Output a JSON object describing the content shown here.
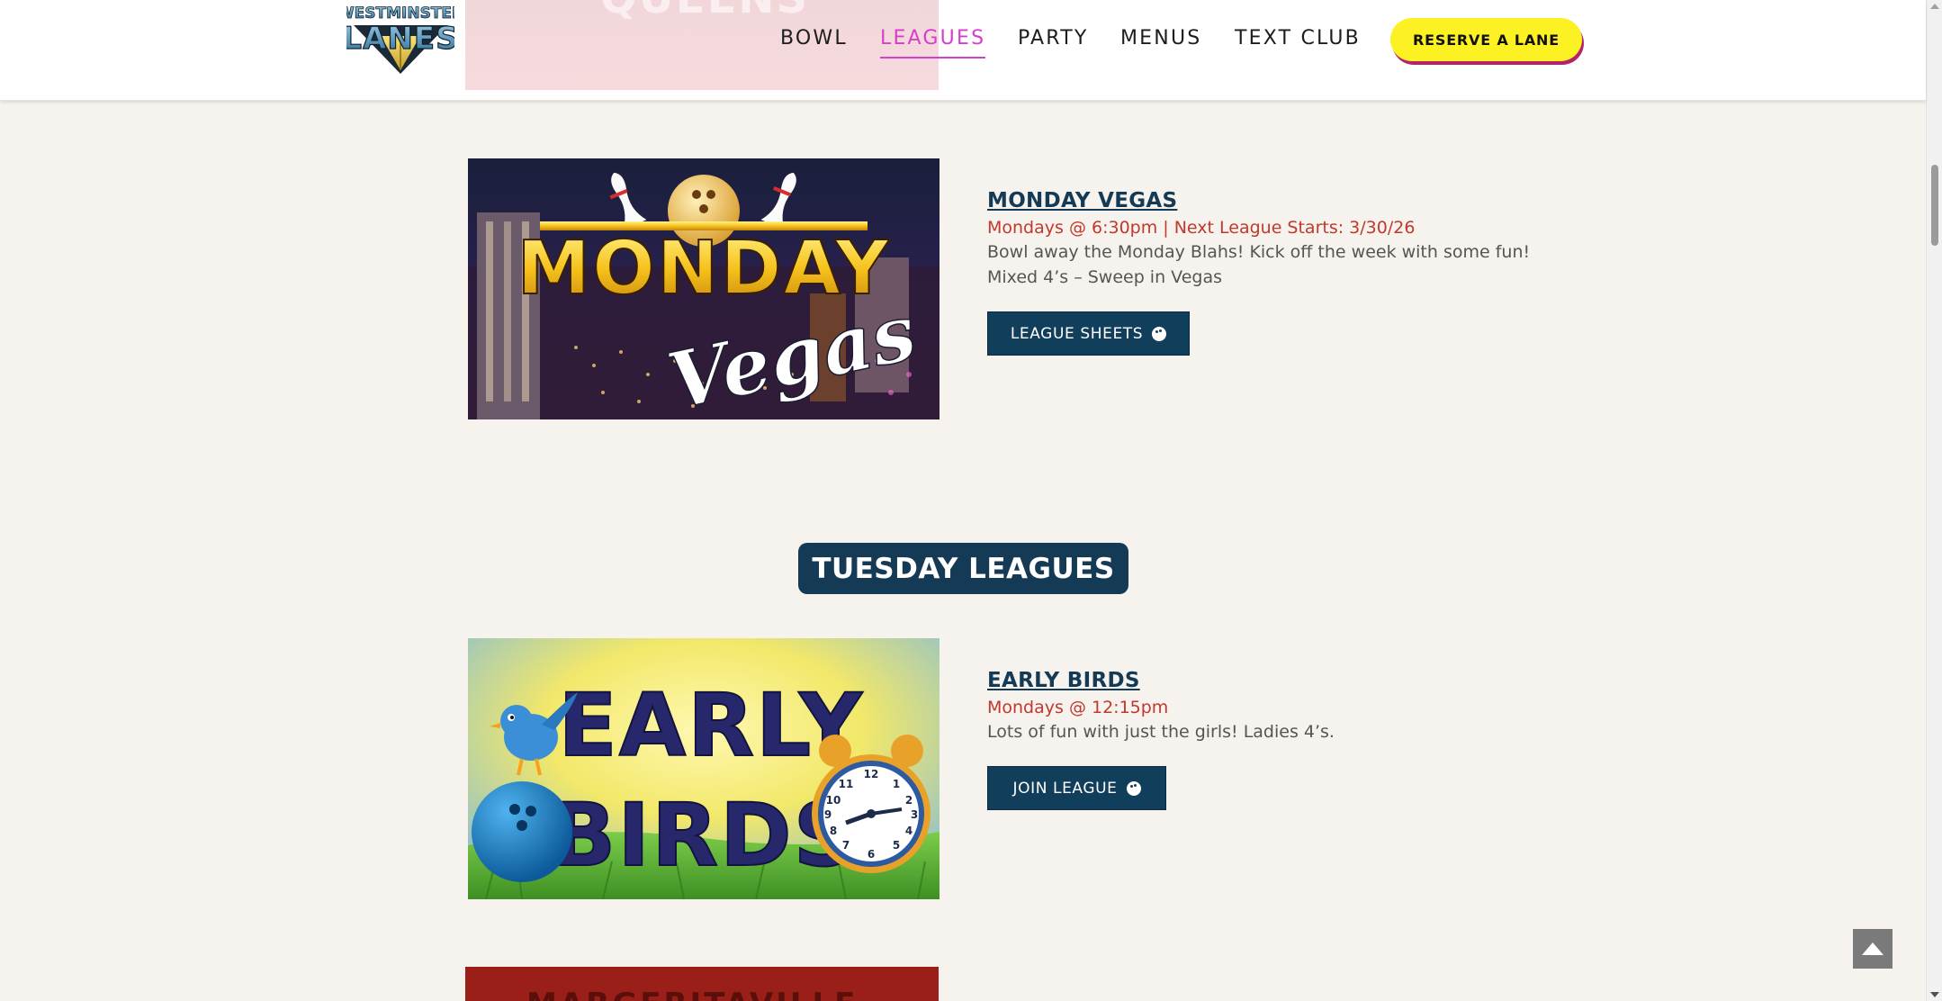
{
  "logo": {
    "line1": "WESTMINSTER",
    "line2": "LANES"
  },
  "nav": {
    "items": [
      {
        "label": "BOWL",
        "active": false
      },
      {
        "label": "LEAGUES",
        "active": true
      },
      {
        "label": "PARTY",
        "active": false
      },
      {
        "label": "MENUS",
        "active": false
      },
      {
        "label": "TEXT CLUB",
        "active": false
      }
    ],
    "cta_label": "RESERVE A LANE"
  },
  "previous_card": {
    "image_text": "QUEENS"
  },
  "leagues": [
    {
      "title": "MONDAY VEGAS",
      "schedule": "Mondays @ 6:30pm | Next League Starts: 3/30/26",
      "description": "Bowl away the Monday Blahs! Kick off the week with some fun! Mixed 4’s – Sweep in Vegas",
      "button_label": "LEAGUE SHEETS",
      "image_text_top": "MONDAY",
      "image_text_script": "Vegas"
    },
    {
      "title": "EARLY BIRDS",
      "schedule": "Mondays @ 12:15pm",
      "description": "Lots of fun with just the girls! Ladies 4’s.",
      "button_label": "JOIN LEAGUE",
      "image_text_top": "EARLY",
      "image_text_bottom": "BIRDS"
    }
  ],
  "section_heading": "TUESDAY LEAGUES",
  "next_card": {
    "image_text": "MARGERITAVILLE"
  },
  "icons": {
    "button_icon": "bowling-ball-icon",
    "scroll_top_icon": "arrow-up-icon"
  },
  "colors": {
    "page_bg": "#f6f3ee",
    "nav_active": "#d63fc9",
    "cta_bg": "#fcf122",
    "title_navy": "#143a55",
    "schedule_red": "#c0392b",
    "button_navy": "#113e5a"
  }
}
